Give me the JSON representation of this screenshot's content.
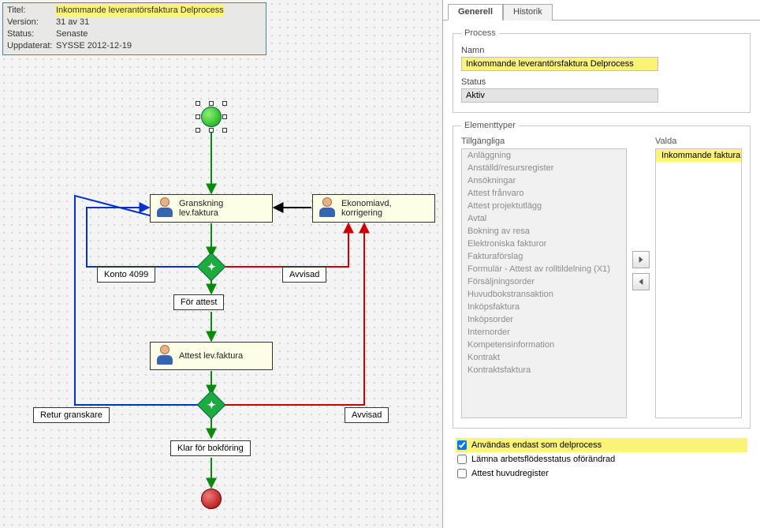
{
  "info": {
    "title_label": "Titel:",
    "title_value": "Inkommande leverantörsfaktura Delprocess",
    "version_label": "Version:",
    "version_value": "31 av 31",
    "status_label": "Status:",
    "status_value": "Senaste",
    "updated_label": "Uppdaterat:",
    "updated_value": "SYSSE  2012-12-19"
  },
  "nodes": {
    "task1_line1": "Granskning",
    "task1_line2": "lev.faktura",
    "task2_line1": "Ekonomiavd,",
    "task2_line2": "korrigering",
    "task3": "Attest lev.faktura",
    "konto": "Konto 4099",
    "for_attest": "För attest",
    "avvisad1": "Avvisad",
    "retur": "Retur granskare",
    "avvisad2": "Avvisad",
    "klar": "Klar för bokföring"
  },
  "tabs": {
    "generell": "Generell",
    "historik": "Historik"
  },
  "process": {
    "legend": "Process",
    "namn_label": "Namn",
    "namn_value": "Inkommande leverantörsfaktura Delprocess",
    "status_label": "Status",
    "status_value": "Aktiv"
  },
  "element": {
    "legend": "Elementtyper",
    "avail_label": "Tillgängliga",
    "selected_label": "Valda",
    "available": [
      "Anläggning",
      "Anställd/resursregister",
      "Ansökningar",
      "Attest frånvaro",
      "Attest projektutlägg",
      "Avtal",
      "Bokning av resa",
      "Elektroniska fakturor",
      "Fakturaförslag",
      "Formulär - Attest av rolltildelning (X1)",
      "Försäljningsorder",
      "Huvudbokstransaktion",
      "Inköpsfaktura",
      "Inköpsorder",
      "Internorder",
      "Kompetensinformation",
      "Kontrakt",
      "Kontraktsfaktura"
    ],
    "selected": [
      "Inkommande faktura"
    ]
  },
  "checks": {
    "c1": "Användas endast som delprocess",
    "c2": "Lämna arbetsflödesstatus oförändrad",
    "c3": "Attest huvudregister"
  }
}
